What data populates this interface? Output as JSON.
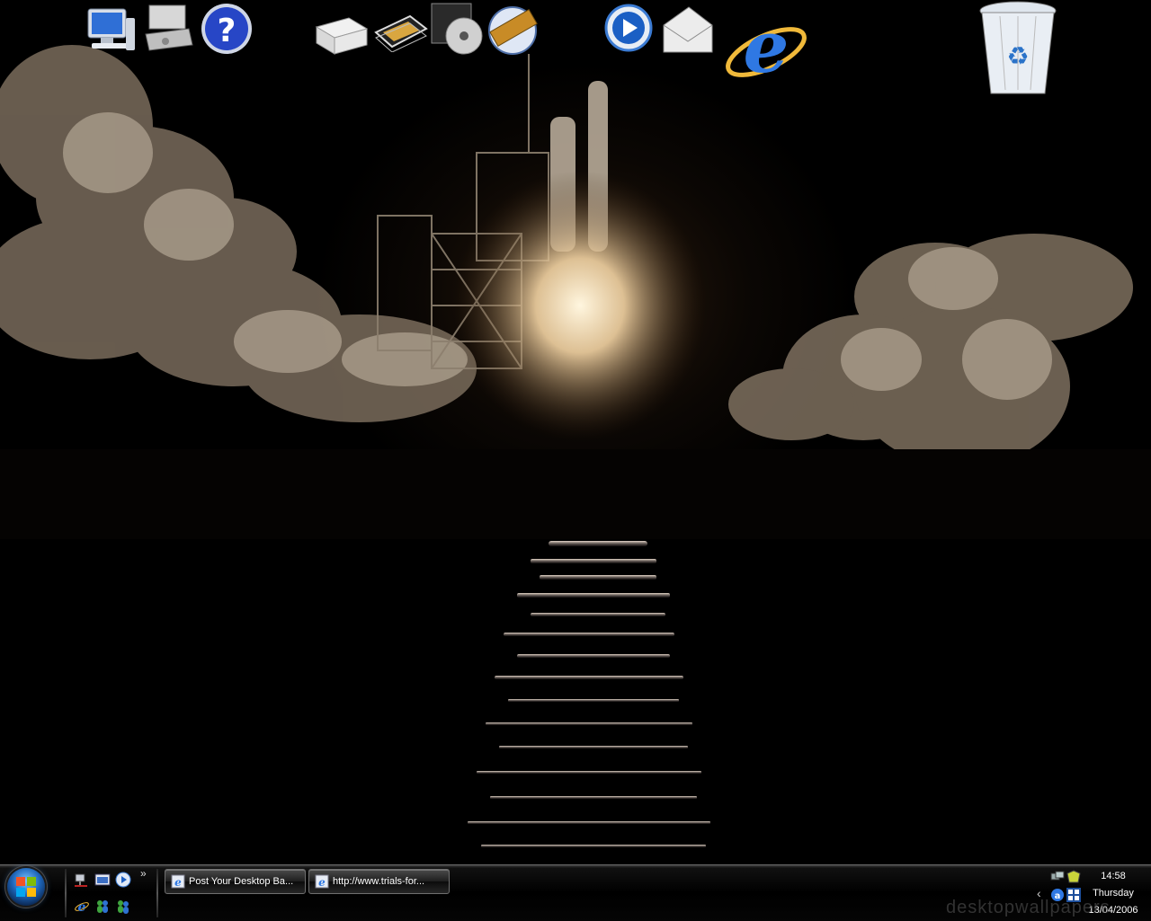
{
  "desktop": {
    "icons": [
      {
        "name": "my-computer-icon"
      },
      {
        "name": "network-drive-icon"
      },
      {
        "name": "help-icon"
      },
      {
        "name": "printer-icon"
      },
      {
        "name": "photo-gallery-icon"
      },
      {
        "name": "cd-burner-icon"
      },
      {
        "name": "movie-maker-icon"
      },
      {
        "name": "media-player-icon"
      },
      {
        "name": "mail-icon"
      },
      {
        "name": "internet-explorer-icon"
      },
      {
        "name": "recycle-bin-icon"
      }
    ],
    "wallpaper": {
      "subject": "space-shuttle-launch-at-night"
    }
  },
  "taskbar": {
    "start_button": {
      "icon": "windows-logo-icon"
    },
    "quick_launch": {
      "icons": [
        "network-icon",
        "show-desktop-icon",
        "media-player-icon",
        "internet-explorer-icon",
        "messenger-icon",
        "messenger-icon"
      ],
      "overflow": "»"
    },
    "tasks": [
      {
        "label": "Post Your Desktop Ba...",
        "icon": "internet-explorer-icon"
      },
      {
        "label": "http://www.trials-for...",
        "icon": "internet-explorer-icon"
      }
    ],
    "tray": {
      "expand": "‹",
      "time": "14:58",
      "day": "Thursday",
      "date": "13/04/2006",
      "icons": [
        "network-icon",
        "security-icon",
        "antivirus-icon",
        "windows-update-icon"
      ]
    },
    "watermark": "desktopwallpapers"
  },
  "colors": {
    "accent": "#1d64b8",
    "taskbar": "#000000"
  }
}
